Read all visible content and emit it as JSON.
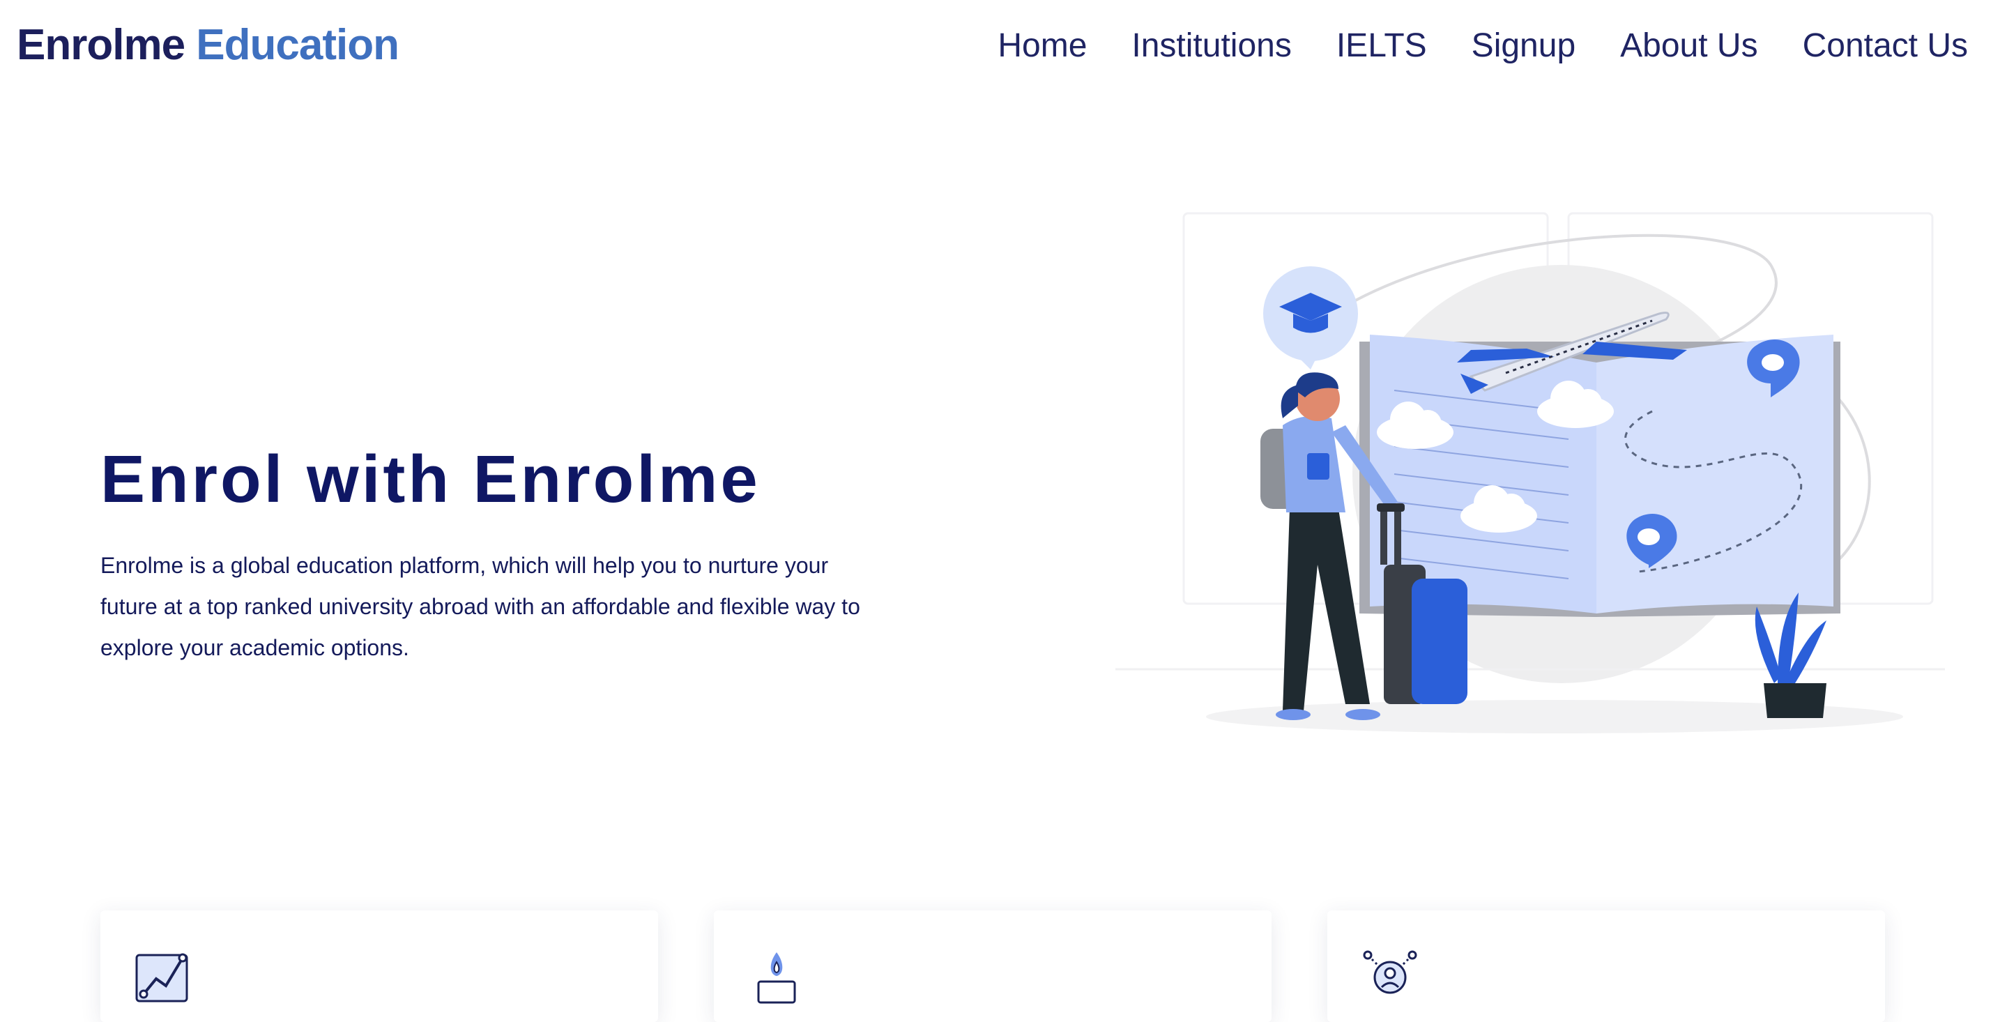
{
  "brand": {
    "part1": "Enrolme",
    "part2": "Education"
  },
  "nav": {
    "items": [
      "Home",
      "Institutions",
      "IELTS",
      "Signup",
      "About Us",
      "Contact Us"
    ]
  },
  "hero": {
    "title": "Enrol with Enrolme",
    "description": "Enrolme is a global education platform, which will help you to nurture your future at a top ranked university abroad with an affordable and flexible way to explore your academic options."
  },
  "features": {
    "icons": [
      "growth-chart-icon",
      "candle-icon",
      "people-icon"
    ]
  },
  "colors": {
    "brand_dark": "#1c1f5c",
    "brand_accent": "#3f70bf",
    "nav_text": "#1f2463",
    "hero_title": "#0f1764",
    "illustration_blue": "#2b5fd9",
    "illustration_light": "#c9d7fb"
  }
}
